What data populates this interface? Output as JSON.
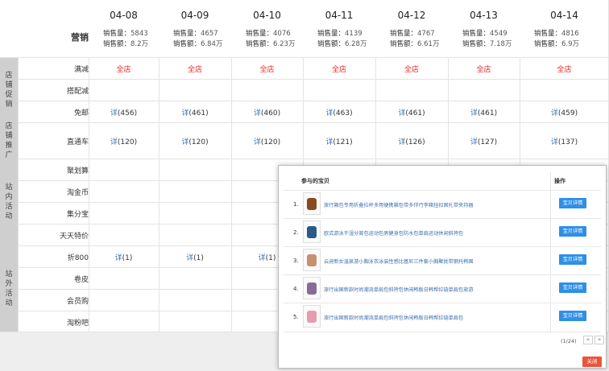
{
  "header": {
    "title": "营销",
    "sales_qty_label": "销售量：",
    "sales_amt_label": "销售额：",
    "dates": [
      {
        "date": "04-08",
        "qty": "5843",
        "amt": "8.2万"
      },
      {
        "date": "04-09",
        "qty": "4657",
        "amt": "6.84万"
      },
      {
        "date": "04-10",
        "qty": "4076",
        "amt": "6.23万"
      },
      {
        "date": "04-11",
        "qty": "4139",
        "amt": "6.28万"
      },
      {
        "date": "04-12",
        "qty": "4767",
        "amt": "6.61万"
      },
      {
        "date": "04-13",
        "qty": "4549",
        "amt": "7.18万"
      },
      {
        "date": "04-14",
        "qty": "4816",
        "amt": "6.9万"
      }
    ]
  },
  "sections": [
    {
      "label": "店\n铺\n促\n销"
    },
    {
      "label": "店\n铺\n推\n广"
    },
    {
      "label": "站\n内\n活\n动"
    },
    {
      "label": "站\n外\n活\n动"
    }
  ],
  "rows": [
    {
      "label": "满减",
      "cells": [
        "全店",
        "全店",
        "全店",
        "全店",
        "全店",
        "全店",
        "全店"
      ]
    },
    {
      "label": "搭配减",
      "cells": []
    },
    {
      "label": "免邮",
      "link": "详",
      "cells": [
        "(456)",
        "(461)",
        "(460)",
        "(463)",
        "(461)",
        "(461)",
        "(459)"
      ]
    },
    {
      "label": "直通车",
      "link": "详",
      "cells": [
        "(120)",
        "(120)",
        "(120)",
        "(121)",
        "(126)",
        "(127)",
        "(137)"
      ]
    },
    {
      "label": "聚划算",
      "cells": []
    },
    {
      "label": "淘金币",
      "cells": []
    },
    {
      "label": "集分宝",
      "cells": []
    },
    {
      "label": "天天特价",
      "cells": []
    },
    {
      "label": "折800",
      "link": "详",
      "cells": [
        "(1)",
        "(1)",
        "(1)"
      ]
    },
    {
      "label": "卷皮",
      "cells": []
    },
    {
      "label": "会员购",
      "cells": []
    },
    {
      "label": "淘粉吧",
      "cells": []
    }
  ],
  "popup": {
    "col_products": "参与的宝贝",
    "col_action": "操作",
    "items": [
      {
        "num": "1.",
        "title": "旅行箱包专用折叠拉杆多用便携箱包带多伴行李箱挂扣固扎带夹持器",
        "thumb_color": "#8a4a20"
      },
      {
        "num": "2.",
        "title": "欧式游泳干湿分离包运动包男健身包防水包单肩运动休闲斜挎包",
        "thumb_color": "#2a5a8a"
      },
      {
        "num": "3.",
        "title": "云迪新女温泉游小胸泳衣泳装性感比基尼三件套小胸聚拢带钢托韩国",
        "thumb_color": "#c89070"
      },
      {
        "num": "4.",
        "title": "旅行出国新款时尚潮流单肩包斜挎包休闲韩版日韩帮拉链单肩包旅游",
        "thumb_color": "#8a6a9a"
      },
      {
        "num": "5.",
        "title": "旅行出国新款时尚潮流单肩包斜挎包休闲韩版日韩帮拉链单肩包",
        "thumb_color": "#e89ab0"
      }
    ],
    "detail_button": "宝贝详情",
    "pager_text": "(1/24)",
    "prev_label": "«",
    "next_label": "»",
    "close_label": "关闭"
  },
  "colors": {
    "red": "#e22222",
    "link": "#3a6fb0",
    "button": "#2f8fe6",
    "close": "#e8553c"
  }
}
